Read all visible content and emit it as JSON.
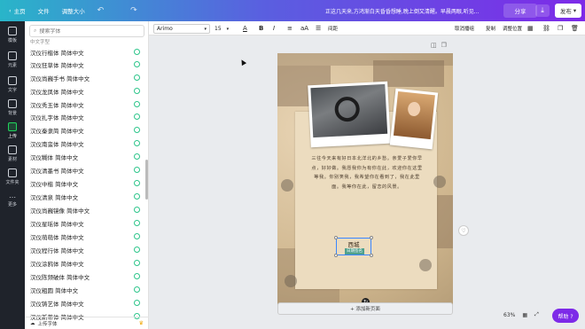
{
  "topbar": {
    "home": "主页",
    "file": "文件",
    "resize": "调整大小",
    "doc_title": "正这几天来,方鸿渐白天昏昏想睡,晚上倒又清醒。早晨两眼,听见...",
    "share": "分享",
    "publish": "发布"
  },
  "rail": [
    {
      "label": "模板",
      "icon": "template-icon"
    },
    {
      "label": "元素",
      "icon": "shapes-icon"
    },
    {
      "label": "文字",
      "icon": "text-icon"
    },
    {
      "label": "背景",
      "icon": "background-icon"
    },
    {
      "label": "上传",
      "icon": "upload-icon"
    },
    {
      "label": "素材",
      "icon": "element-icon"
    },
    {
      "label": "文件夹",
      "icon": "folder-icon"
    },
    {
      "label": "更多",
      "icon": "more-icon"
    }
  ],
  "panel": {
    "search_placeholder": "搜索字体",
    "section_label": "中文字型",
    "fonts": [
      "汉仪行楷体 简体中文",
      "汉仪狂草体 简体中文",
      "汉仪尚巍手书 简体中文",
      "汉仪龙凤体 简体中文",
      "汉仪秀玉体 简体中文",
      "汉仪扎字体 简体中文",
      "汉仪秦隶简 简体中文",
      "汉仪南蛮体 简体中文",
      "汉仪糊体 简体中文",
      "汉仪清墨书 简体中文",
      "汉仪中楷 简体中文",
      "汉仪清泉 简体中文",
      "汉仪尚巍镜像 简体中文",
      "汉仪星瑶体 简体中文",
      "汉仪萌萌体 简体中文",
      "汉仪程行体 简体中文",
      "汉仪涂鸦体 简体中文",
      "汉仪陈频破体 简体中文",
      "汉仪粗圆 简体中文",
      "汉仪铸艺体 简体中文",
      "汉仪新蒂体 简体中文"
    ],
    "upload_label": "上传字体"
  },
  "toolbar": {
    "font_name": "Arimo",
    "font_size": "15",
    "spacing": "间距",
    "ungroup": "取消播组",
    "copy": "复制",
    "position": "调整位置"
  },
  "canvas": {
    "poem": "三往今天来有好日本北洋北的乡愁。亲爱子爱你早点，好好做。我愿我你为有你在此，欢迎你在这里等我。你别笑我，我希望你在看到了，我在此里面。我等你在此，留恋的风景。",
    "sig_name": "西城",
    "sig_date": "日期签名",
    "add_page": "+ 添加新页面"
  },
  "bottom": {
    "zoom": "63%",
    "help": "帮助 ?"
  },
  "colors": {
    "accent": "#7d2ae8",
    "teal": "#29b5c9",
    "rail_bg": "#1f232b",
    "selection": "#3a86ff"
  }
}
